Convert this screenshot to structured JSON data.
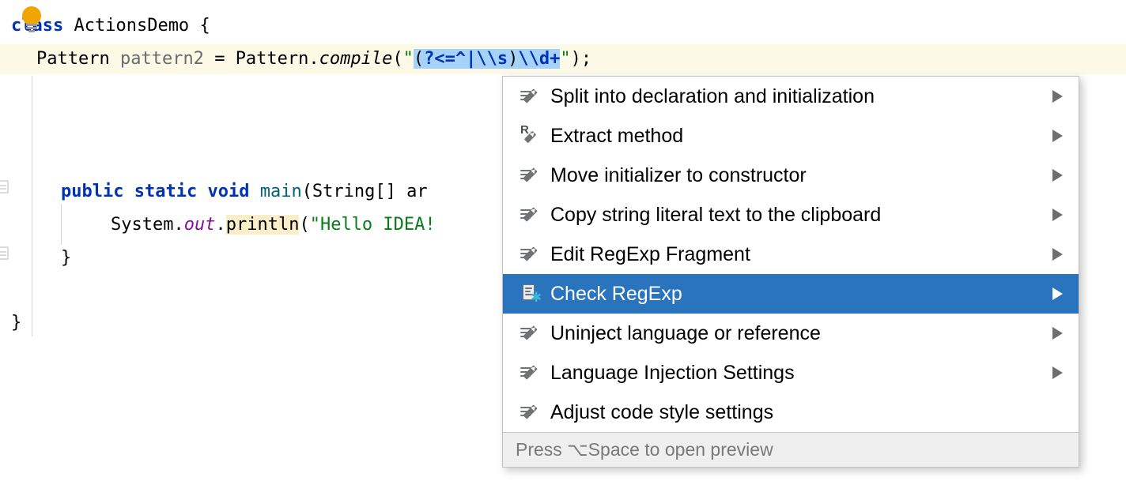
{
  "editor": {
    "lines": [
      {
        "id": "line-1",
        "segments": [
          {
            "text": "c",
            "style": "kw"
          },
          {
            "text": "lass",
            "style": "kw"
          },
          {
            "text": " ",
            "style": "plain"
          },
          {
            "text": "ActionsDemo",
            "style": "plain"
          },
          {
            "text": " {",
            "style": "plain"
          }
        ],
        "raw": "class ActionsDemo {"
      },
      {
        "id": "line-2",
        "raw": "    Pattern pattern2 = Pattern.compile(\"(?<=^|\\\\s)\\\\d+\");"
      },
      {
        "id": "line-main",
        "raw": "        public static void main(String[] ar"
      },
      {
        "id": "line-print",
        "raw": "            System.out.println(\"Hello IDEA!"
      },
      {
        "id": "line-close-method",
        "raw": "        }"
      },
      {
        "id": "line-close-class",
        "raw": "}"
      }
    ],
    "tokens": {
      "kw_class": "class",
      "type_name": "ActionsDemo",
      "brace_open": "{",
      "pattern_type": "Pattern",
      "pattern_var": "pattern2",
      "equals": "=",
      "pattern_class": "Pattern",
      "dot": ".",
      "compile": "compile",
      "paren_open": "(",
      "quote": "\"",
      "regex_selected": "(?<=^|\\\\s)\\\\d+",
      "paren_close_semi": ");",
      "kw_public": "public",
      "kw_static": "static",
      "kw_void": "void",
      "main": "main",
      "main_args": "(String[] ar",
      "system": "System",
      "out": "out",
      "println": "println",
      "hello_string": "\"Hello IDEA!",
      "close_brace": "}"
    },
    "lightbulb": "lightbulb-icon"
  },
  "popup": {
    "items": [
      {
        "label": "Split into declaration and initialization",
        "icon": "intention-icon",
        "has_submenu": true,
        "selected": false
      },
      {
        "label": "Extract method",
        "icon": "refactor-icon",
        "has_submenu": true,
        "selected": false
      },
      {
        "label": "Move initializer to constructor",
        "icon": "intention-icon",
        "has_submenu": true,
        "selected": false
      },
      {
        "label": "Copy string literal text to the clipboard",
        "icon": "intention-icon",
        "has_submenu": true,
        "selected": false
      },
      {
        "label": "Edit RegExp Fragment",
        "icon": "intention-icon",
        "has_submenu": true,
        "selected": false
      },
      {
        "label": "Check RegExp",
        "icon": "regexp-check-icon",
        "has_submenu": true,
        "selected": true
      },
      {
        "label": "Uninject language or reference",
        "icon": "intention-icon",
        "has_submenu": true,
        "selected": false
      },
      {
        "label": "Language Injection Settings",
        "icon": "intention-icon",
        "has_submenu": true,
        "selected": false
      },
      {
        "label": "Adjust code style settings",
        "icon": "intention-icon",
        "has_submenu": false,
        "selected": false
      }
    ],
    "footer": "Press ⌥Space to open preview"
  },
  "colors": {
    "selection_blue": "#2a74bd",
    "regex_selection": "#a6d2fa",
    "current_line": "#fcfae7",
    "identifier_highlight": "#faeec8",
    "keyword": "#0033b3",
    "string": "#067d17",
    "field": "#871094",
    "method": "#00627a",
    "lightbulb": "#f0a500",
    "regexp_star": "#3bb8d8",
    "footer_bg": "#efeff0",
    "footer_text": "#797979"
  }
}
